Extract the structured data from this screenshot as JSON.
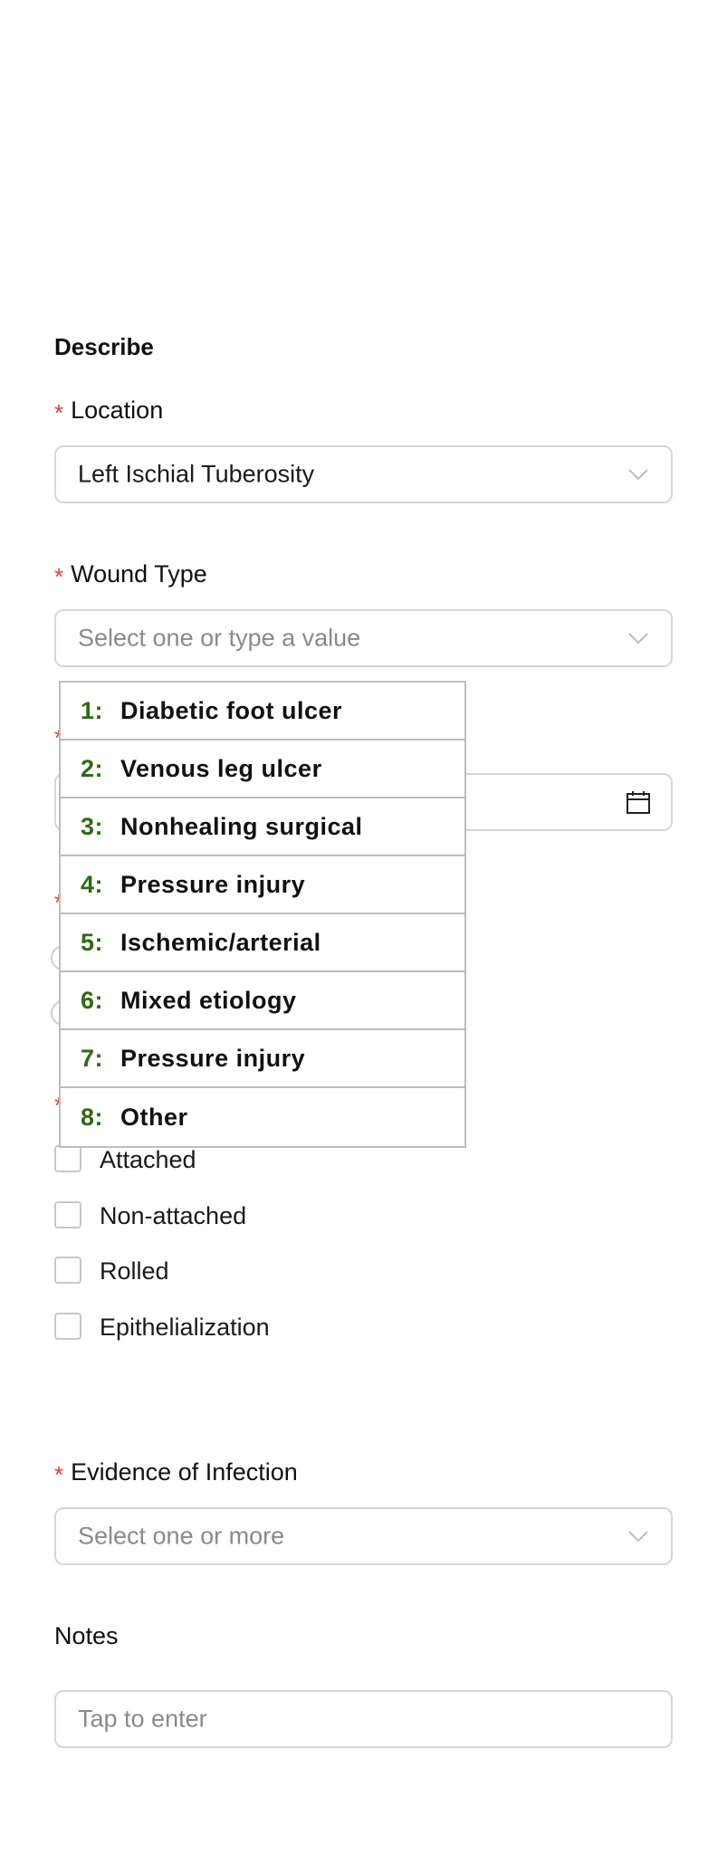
{
  "section": {
    "title": "Describe"
  },
  "location": {
    "label": "Location",
    "value": "Left Ischial Tuberosity"
  },
  "wound_type": {
    "label": "Wound Type",
    "placeholder": "Select one or type a value",
    "options": [
      {
        "num": "1:",
        "label": "Diabetic foot ulcer"
      },
      {
        "num": "2:",
        "label": "Venous leg ulcer"
      },
      {
        "num": "3:",
        "label": "Nonhealing surgical"
      },
      {
        "num": "4:",
        "label": "Pressure injury"
      },
      {
        "num": "5:",
        "label": "Ischemic/arterial"
      },
      {
        "num": "6:",
        "label": "Mixed etiology"
      },
      {
        "num": "7:",
        "label": "Pressure injury"
      },
      {
        "num": "8:",
        "label": "Other"
      }
    ]
  },
  "edges": {
    "options": [
      {
        "label": "Attached"
      },
      {
        "label": "Non-attached"
      },
      {
        "label": "Rolled"
      },
      {
        "label": "Epithelialization"
      }
    ]
  },
  "infection": {
    "label": "Evidence of Infection",
    "placeholder": "Select one or more"
  },
  "notes": {
    "label": "Notes",
    "placeholder": "Tap to enter"
  },
  "required_marker": "*",
  "icons": {
    "dropdown": "chevron-down-icon",
    "date": "calendar-icon"
  },
  "colors": {
    "required": "#e53935",
    "option_number": "#2e6b10"
  }
}
